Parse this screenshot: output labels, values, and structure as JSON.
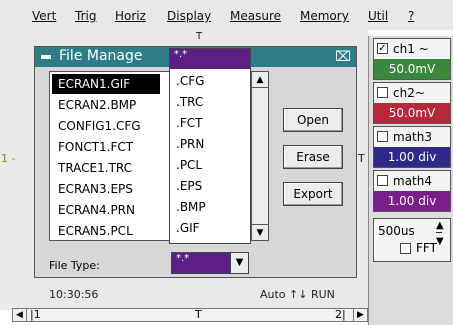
{
  "menu": [
    "Vert",
    "Trig",
    "Horiz",
    "Display",
    "Measure",
    "Memory",
    "Util",
    "?"
  ],
  "scope": {
    "top_marker": "T",
    "left_marker": "1",
    "timestamp": "10:30:56",
    "trigger_status": "Auto",
    "trigger_state": "RUN",
    "right_tick": "T",
    "scrollbar": {
      "marker_left": "1",
      "marker_mid": "T",
      "marker_right": "2"
    }
  },
  "channels": [
    {
      "name": "ch1",
      "suffix": "~",
      "value": "50.0mV",
      "checked": true,
      "color": "#3a8a3e"
    },
    {
      "name": "ch2",
      "suffix": "~",
      "value": "50.0mV",
      "checked": false,
      "color": "#b8283a"
    },
    {
      "name": "math3",
      "suffix": "",
      "value": "1.00 div",
      "checked": false,
      "color": "#2e2a8c"
    },
    {
      "name": "math4",
      "suffix": "",
      "value": "1.00 div",
      "checked": false,
      "color": "#7a1e8a"
    }
  ],
  "timebase": {
    "value": "500us",
    "fft_label": "FFT",
    "fft_checked": false
  },
  "dialog": {
    "title": "File Manage",
    "files": [
      "ECRAN1.GIF",
      "ECRAN2.BMP",
      "CONFIG1.CFG",
      "FONCT1.FCT",
      "TRACE1.TRC",
      "ECRAN3.EPS",
      "ECRAN4.PRN",
      "ECRAN5.PCL"
    ],
    "selected_index": 0,
    "buttons": {
      "open": "Open",
      "erase": "Erase",
      "export": "Export"
    },
    "file_type_label": "File Type:",
    "file_type_value": "*.*"
  },
  "extension_dropdown": {
    "header": "*.*",
    "options": [
      ".CFG",
      ".TRC",
      ".FCT",
      ".PRN",
      ".PCL",
      ".EPS",
      ".BMP",
      ".GIF"
    ]
  },
  "colors": {
    "title_bar": "#2d7d86",
    "dropdown_header": "#5b1f86"
  }
}
